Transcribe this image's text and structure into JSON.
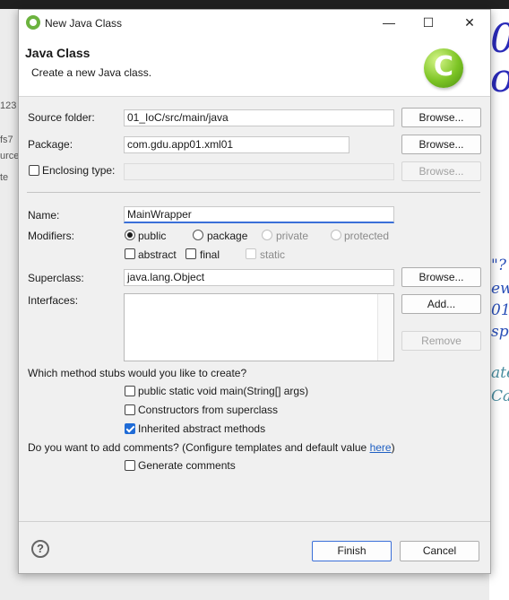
{
  "background": {
    "frag_left": [
      "123",
      "fs7",
      "urces",
      "te"
    ],
    "code_right": [
      "\"?",
      "ew",
      "01",
      "sp",
      "ate",
      "Ca"
    ],
    "big_right_1": "0",
    "big_right_2": "o"
  },
  "window": {
    "title": "New Java Class",
    "minimize": "—",
    "maximize": "☐",
    "close": "✕"
  },
  "header": {
    "title": "Java Class",
    "description": "Create a new Java class.",
    "logo_letter": "C"
  },
  "form": {
    "source_folder": {
      "label": "Source folder:",
      "value": "01_IoC/src/main/java",
      "button": "Browse..."
    },
    "package": {
      "label": "Package:",
      "value": "com.gdu.app01.xml01",
      "button": "Browse..."
    },
    "enclosing_type": {
      "label": "Enclosing type:",
      "value": "",
      "button": "Browse...",
      "checked": false
    },
    "name": {
      "label": "Name:",
      "value": "MainWrapper"
    },
    "modifiers": {
      "label": "Modifiers:",
      "public": "public",
      "package": "package",
      "private": "private",
      "protected": "protected",
      "abstract": "abstract",
      "final": "final",
      "static": "static",
      "selected": "public"
    },
    "superclass": {
      "label": "Superclass:",
      "value": "java.lang.Object",
      "button": "Browse..."
    },
    "interfaces": {
      "label": "Interfaces:",
      "add_button": "Add...",
      "remove_button": "Remove",
      "items": []
    },
    "stubs": {
      "question": "Which method stubs would you like to create?",
      "main": {
        "label": "public static void main(String[] args)",
        "checked": false
      },
      "constructors": {
        "label": "Constructors from superclass",
        "checked": false
      },
      "inherited": {
        "label": "Inherited abstract methods",
        "checked": true
      }
    },
    "comments": {
      "question_prefix": "Do you want to add comments? (Configure templates and default value ",
      "link": "here",
      "question_suffix": ")",
      "generate": {
        "label": "Generate comments",
        "checked": false
      }
    }
  },
  "footer": {
    "help_icon": "?",
    "finish": "Finish",
    "cancel": "Cancel"
  },
  "colors": {
    "accent": "#3a6fd8",
    "link": "#1f5fc2",
    "checkbox_checked": "#1f6bd6",
    "logo": "#7cc424"
  }
}
